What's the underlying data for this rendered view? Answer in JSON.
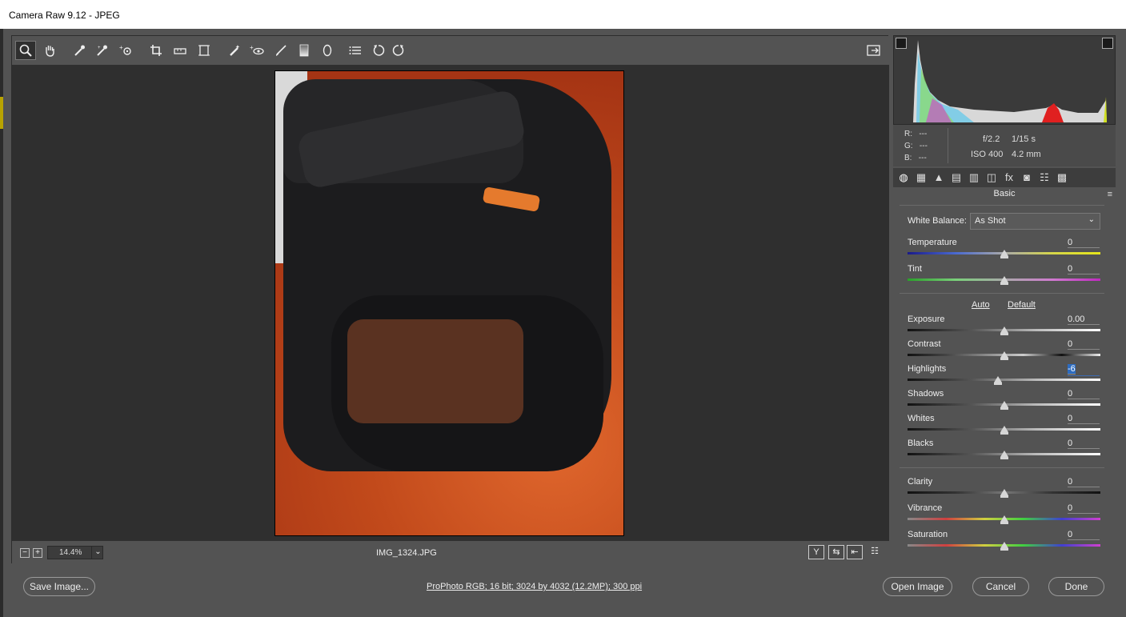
{
  "window": {
    "title": "Camera Raw 9.12  -  JPEG"
  },
  "toolbar": {
    "tools": [
      {
        "name": "zoom-tool",
        "glyph": "🔍"
      },
      {
        "name": "hand-tool",
        "glyph": "✋"
      },
      {
        "name": "white-balance-tool",
        "glyph": "✒"
      },
      {
        "name": "color-sampler-tool",
        "glyph": "✒"
      },
      {
        "name": "targeted-adjustment-tool",
        "glyph": "◎"
      },
      {
        "name": "crop-tool",
        "glyph": "⌗"
      },
      {
        "name": "straighten-tool",
        "glyph": "▭"
      },
      {
        "name": "transform-tool",
        "glyph": "▣"
      },
      {
        "name": "spot-removal-tool",
        "glyph": "✎"
      },
      {
        "name": "red-eye-tool",
        "glyph": "◉"
      },
      {
        "name": "adjustment-brush",
        "glyph": "✐"
      },
      {
        "name": "graduated-filter",
        "glyph": "▮"
      },
      {
        "name": "radial-filter",
        "glyph": "◯"
      },
      {
        "name": "preferences",
        "glyph": "☰"
      },
      {
        "name": "rotate-left",
        "glyph": "↺"
      },
      {
        "name": "rotate-right",
        "glyph": "↻"
      }
    ],
    "fullscreen_icon": "⇱"
  },
  "status": {
    "zoom_out": "−",
    "zoom_in": "+",
    "zoom": "14.4%",
    "zoom_dropdown": "⌄",
    "filename": "IMG_1324.JPG",
    "right_icons": [
      "Y",
      "⇆",
      "⇤",
      "☷"
    ]
  },
  "histogram": {
    "rgb": {
      "r_label": "R:",
      "r": "---",
      "g_label": "G:",
      "g": "---",
      "b_label": "B:",
      "b": "---"
    },
    "aperture": "f/2.2",
    "shutter": "1/15 s",
    "iso": "ISO 400",
    "focal": "4.2 mm"
  },
  "panel": {
    "tabs": [
      "◍",
      "▦",
      "▲",
      "▤",
      "▥",
      "◫",
      "fx",
      "◙",
      "☷",
      "▩"
    ],
    "title": "Basic",
    "menu_icon": "≡",
    "white_balance_label": "White Balance:",
    "white_balance_value": "As Shot",
    "auto": "Auto",
    "default": "Default",
    "sliders": [
      {
        "name": "temperature",
        "label": "Temperature",
        "value": "0",
        "pos": 0.5
      },
      {
        "name": "tint",
        "label": "Tint",
        "value": "0",
        "pos": 0.5
      },
      {
        "name": "exposure",
        "label": "Exposure",
        "value": "0.00",
        "pos": 0.5
      },
      {
        "name": "contrast",
        "label": "Contrast",
        "value": "0",
        "pos": 0.5
      },
      {
        "name": "highlights",
        "label": "Highlights",
        "value": "-6",
        "pos": 0.47
      },
      {
        "name": "shadows",
        "label": "Shadows",
        "value": "0",
        "pos": 0.5
      },
      {
        "name": "whites",
        "label": "Whites",
        "value": "0",
        "pos": 0.5
      },
      {
        "name": "blacks",
        "label": "Blacks",
        "value": "0",
        "pos": 0.5
      },
      {
        "name": "clarity",
        "label": "Clarity",
        "value": "0",
        "pos": 0.5
      },
      {
        "name": "vibrance",
        "label": "Vibrance",
        "value": "0",
        "pos": 0.5
      },
      {
        "name": "saturation",
        "label": "Saturation",
        "value": "0",
        "pos": 0.5
      }
    ]
  },
  "footer": {
    "save": "Save Image...",
    "workflow": "ProPhoto RGB; 16 bit; 3024 by 4032 (12.2MP); 300 ppi",
    "open": "Open Image",
    "cancel": "Cancel",
    "done": "Done"
  },
  "colors": {
    "background": "#535353",
    "canvas": "#2f2f2f",
    "accent": "#2d6cc0"
  }
}
